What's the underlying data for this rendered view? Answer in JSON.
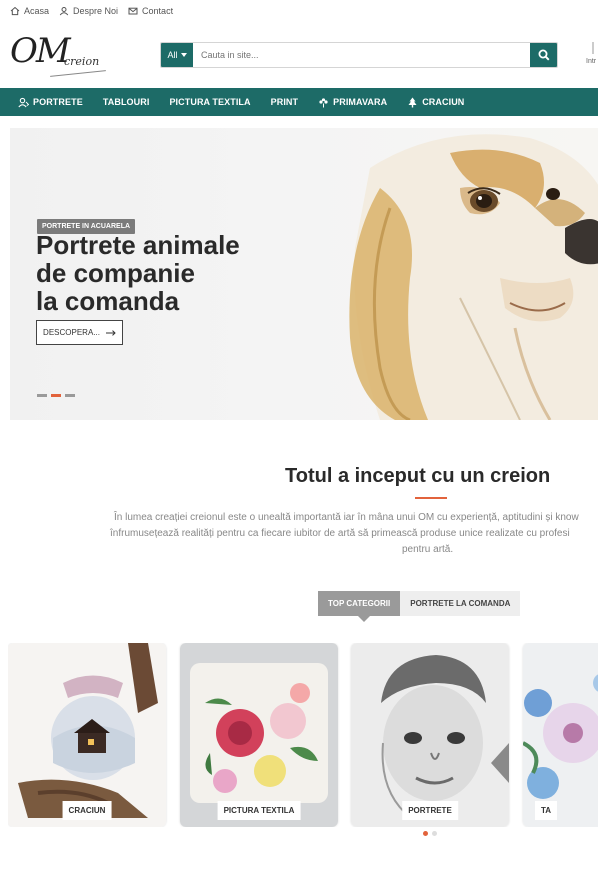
{
  "topbar": {
    "home": "Acasa",
    "about": "Despre Noi",
    "contact": "Contact"
  },
  "logo": {
    "main": "OM",
    "sub": "creion"
  },
  "search": {
    "category": "All",
    "placeholder": "Cauta in site..."
  },
  "header_edge": "Intr",
  "nav": [
    {
      "label": "PORTRETE",
      "icon": "portrait-icon"
    },
    {
      "label": "TABLOURI",
      "icon": ""
    },
    {
      "label": "PICTURA TEXTILA",
      "icon": ""
    },
    {
      "label": "PRINT",
      "icon": ""
    },
    {
      "label": "PRIMAVARA",
      "icon": "flower-icon"
    },
    {
      "label": "CRACIUN",
      "icon": "tree-icon"
    }
  ],
  "hero": {
    "badge": "PORTRETE IN ACUARELA",
    "title_line1": "Portrete animale",
    "title_line2": "de companie",
    "title_line3": "la comanda",
    "button": "DESCOPERA..."
  },
  "intro": {
    "title": "Totul a inceput cu un creion",
    "line1": "În lumea creației creionul este o unealtă importantă iar în mâna unui OM cu experiență, aptitudini și know",
    "line2": "înfrumusețează realități pentru ca fiecare iubitor de artă să primească produse unice realizate cu profesi",
    "line3": "pentru artă."
  },
  "tabs": {
    "active": "TOP CATEGORII",
    "inactive": "PORTRETE LA COMANDA"
  },
  "cards": [
    {
      "label": "CRACIUN"
    },
    {
      "label": "PICTURA TEXTILA"
    },
    {
      "label": "PORTRETE"
    },
    {
      "label": "TA"
    }
  ],
  "colors": {
    "brand": "#1d6b67",
    "accent": "#e2633c",
    "badge": "#7b7b7b"
  }
}
